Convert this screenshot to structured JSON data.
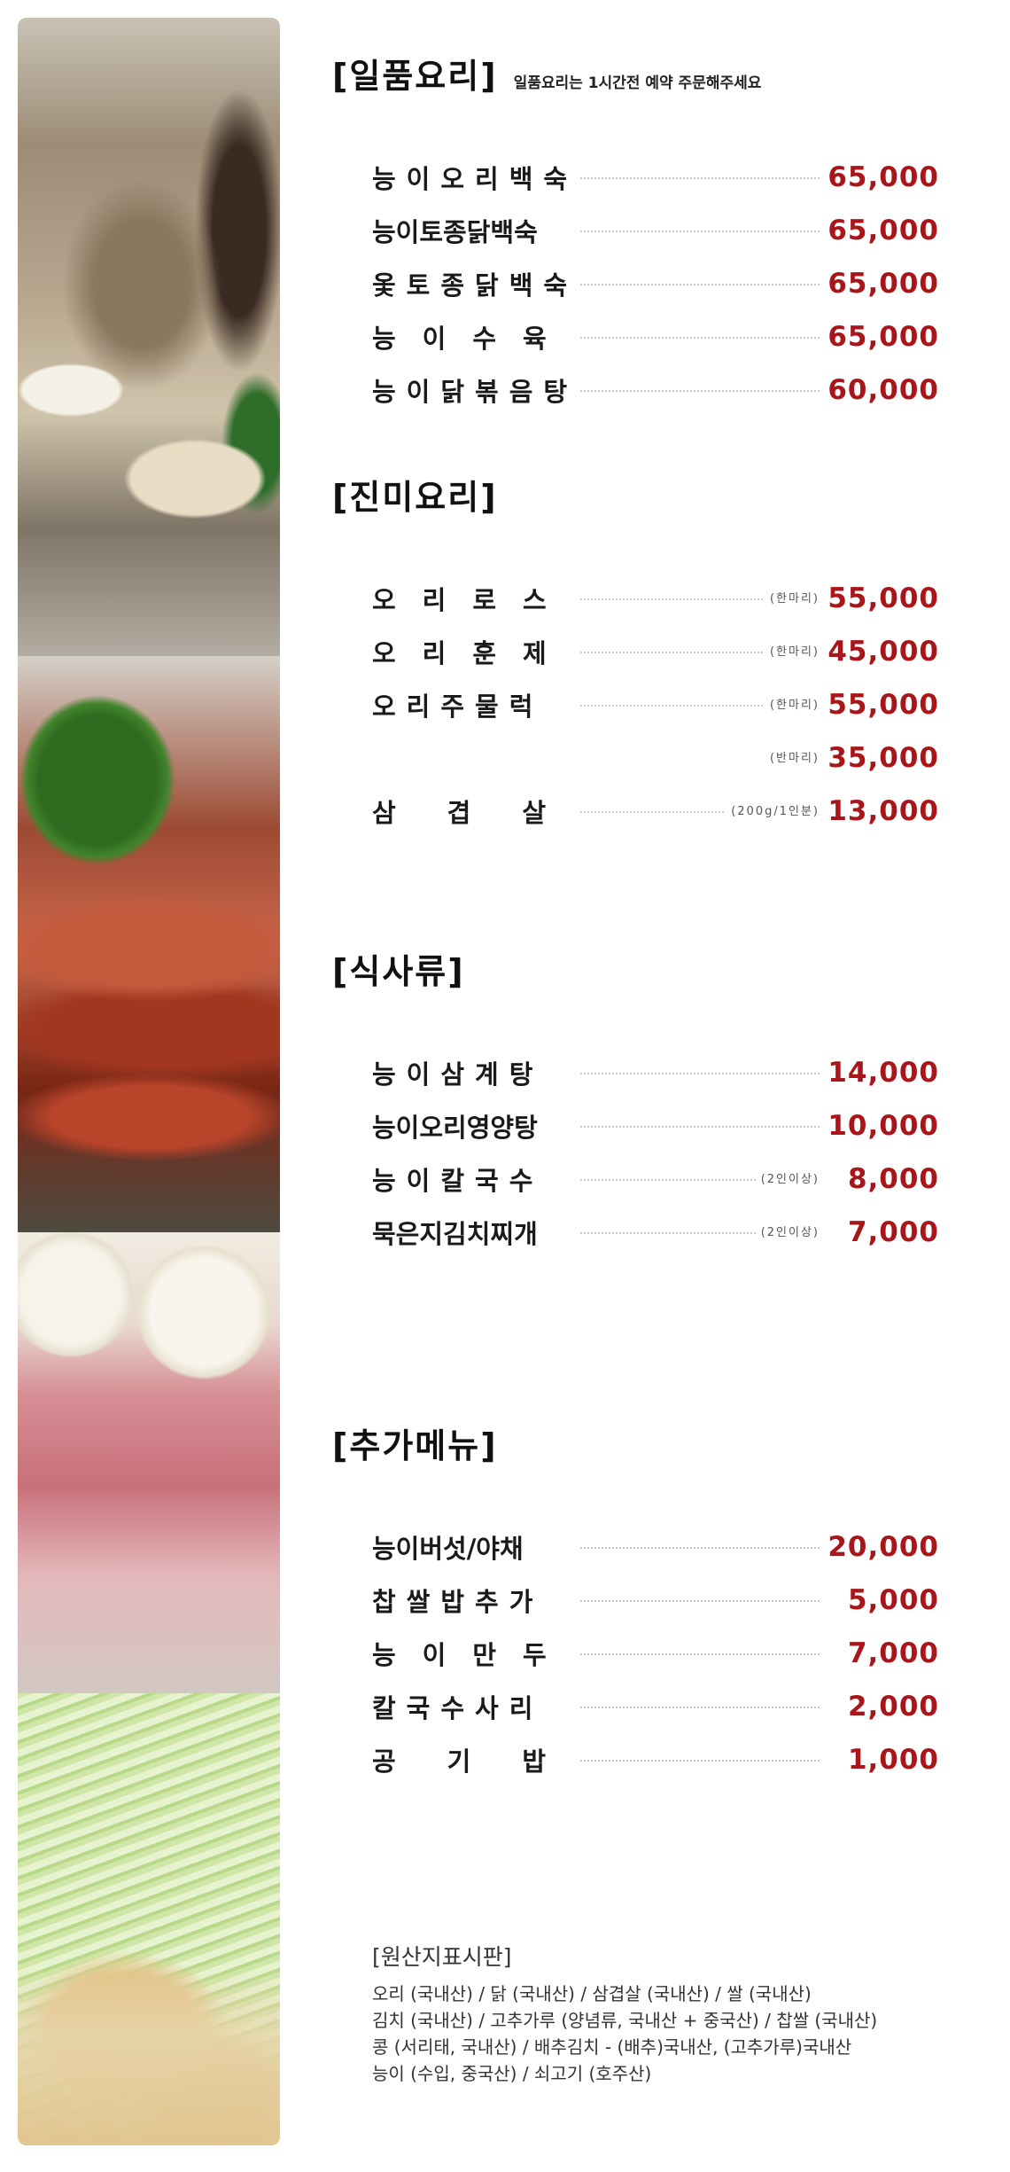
{
  "sections": [
    {
      "title": "[일품요리]",
      "note": "일품요리는 1시간전 예약 주문해주세요",
      "items": [
        {
          "name": "능이오리백숙",
          "note": "",
          "price": "65,000"
        },
        {
          "name": "능이토종닭백숙",
          "note": "",
          "price": "65,000"
        },
        {
          "name": "옻토종닭백숙",
          "note": "",
          "price": "65,000"
        },
        {
          "name": "능이수육",
          "note": "",
          "price": "65,000"
        },
        {
          "name": "능이닭볶음탕",
          "note": "",
          "price": "60,000"
        }
      ]
    },
    {
      "title": "[진미요리]",
      "note": "",
      "items": [
        {
          "name": "오리로스",
          "note": "(한마리)",
          "price": "55,000"
        },
        {
          "name": "오리훈제",
          "note": "(한마리)",
          "price": "45,000"
        },
        {
          "name": "오리주물럭",
          "note": "(한마리)",
          "price": "55,000"
        },
        {
          "name": "",
          "note": "(반마리)",
          "price": "35,000"
        },
        {
          "name": "삼겹살",
          "note": "(200g/1인분)",
          "price": "13,000"
        }
      ]
    },
    {
      "title": "[식사류]",
      "note": "",
      "items": [
        {
          "name": "능이삼계탕",
          "note": "",
          "price": "14,000"
        },
        {
          "name": "능이오리영양탕",
          "note": "",
          "price": "10,000"
        },
        {
          "name": "능이칼국수",
          "note": "(2인이상)",
          "price": "8,000"
        },
        {
          "name": "묵은지김치찌개",
          "note": "(2인이상)",
          "price": "7,000"
        }
      ]
    },
    {
      "title": "[추가메뉴]",
      "note": "",
      "items": [
        {
          "name": "능이버섯/야채",
          "note": "",
          "price": "20,000"
        },
        {
          "name": "찹쌀밥추가",
          "note": "",
          "price": "5,000"
        },
        {
          "name": "능이만두",
          "note": "",
          "price": "7,000"
        },
        {
          "name": "칼국수사리",
          "note": "",
          "price": "2,000"
        },
        {
          "name": "공기밥",
          "note": "",
          "price": "1,000"
        }
      ]
    }
  ],
  "origin": {
    "title": "[원산지표시판]",
    "lines": [
      "오리 (국내산) / 닭 (국내산) / 삼겹살 (국내산) / 쌀 (국내산)",
      "김치 (국내산) / 고추가루 (양념류, 국내산 + 중국산) / 찹쌀 (국내산)",
      "콩 (서리태, 국내산) / 배추김치 - (배추)국내산, (고추가루)국내산",
      "능이 (수입, 중국산) / 쇠고기 (호주산)"
    ]
  },
  "photos": [
    {
      "icon": "boiled-duck-soup-photo"
    },
    {
      "icon": "smoked-duck-photo"
    },
    {
      "icon": "raw-pork-onion-photo"
    },
    {
      "icon": "cucumber-noodle-photo"
    }
  ]
}
